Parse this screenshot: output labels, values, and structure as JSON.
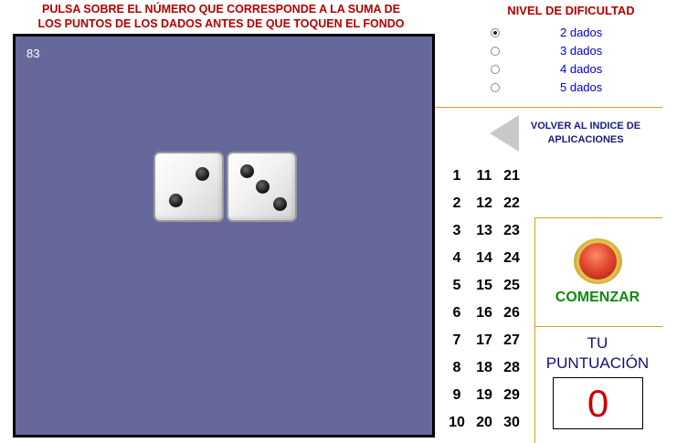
{
  "instructions": {
    "line1": "PULSA SOBRE EL NÚMERO QUE CORRESPONDE A LA SUMA DE",
    "line2": "LOS PUNTOS DE LOS DADOS ANTES DE QUE TOQUEN EL FONDO"
  },
  "game": {
    "timer": "83",
    "dice_values": [
      2,
      3
    ]
  },
  "difficulty": {
    "title": "NIVEL DE DIFICULTAD",
    "options": [
      {
        "label": "2 dados",
        "checked": true
      },
      {
        "label": "3 dados",
        "checked": false
      },
      {
        "label": "4 dados",
        "checked": false
      },
      {
        "label": "5 dados",
        "checked": false
      }
    ]
  },
  "back_link": {
    "line1": "VOLVER AL  INDICE DE",
    "line2": "APLICACIONES"
  },
  "numbers": [
    [
      "1",
      "11",
      "21"
    ],
    [
      "2",
      "12",
      "22"
    ],
    [
      "3",
      "13",
      "23"
    ],
    [
      "4",
      "14",
      "24"
    ],
    [
      "5",
      "15",
      "25"
    ],
    [
      "6",
      "16",
      "26"
    ],
    [
      "7",
      "17",
      "27"
    ],
    [
      "8",
      "18",
      "28"
    ],
    [
      "9",
      "19",
      "29"
    ],
    [
      "10",
      "20",
      "30"
    ]
  ],
  "start": {
    "label": "COMENZAR"
  },
  "score": {
    "title_line1": "TU",
    "title_line2": "PUNTUACIÓN",
    "value": "0"
  },
  "colors": {
    "game_bg": "#66689c",
    "instruction_red": "#b30000",
    "divider_gold": "#d4a017",
    "start_green": "#0e8a0e",
    "score_red": "#cc0000"
  }
}
